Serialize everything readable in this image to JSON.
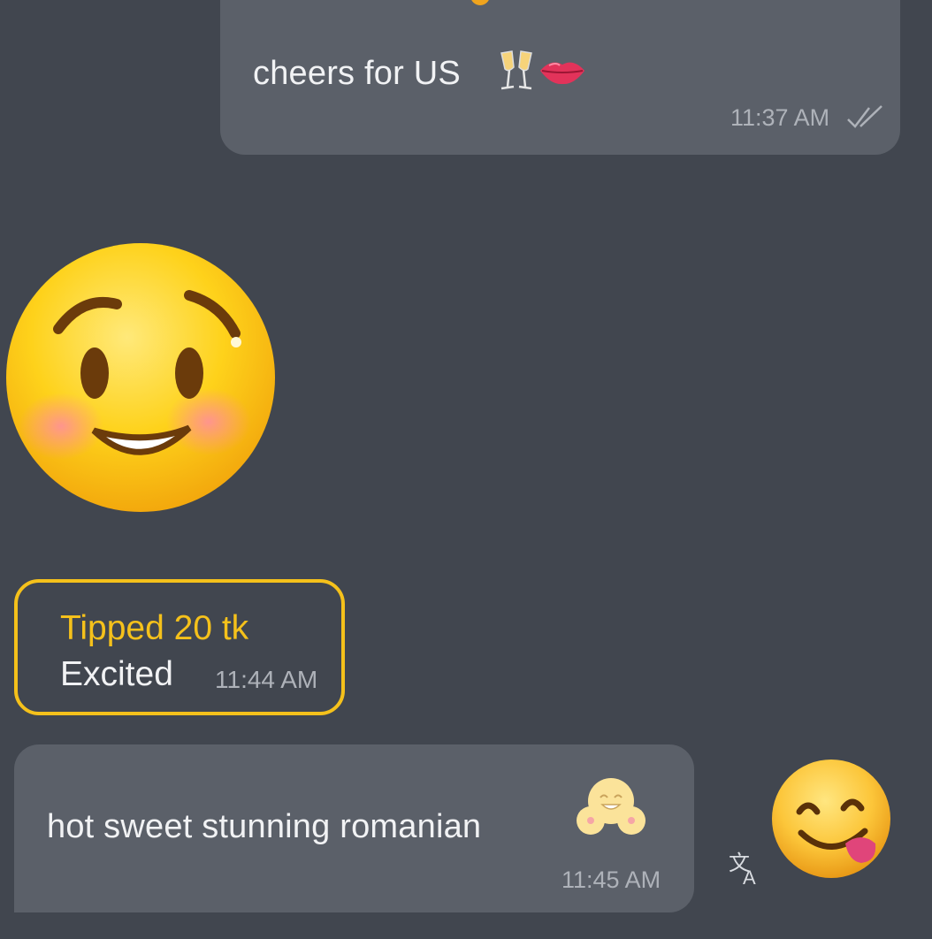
{
  "messages": {
    "outgoing": {
      "text": "cheers for US",
      "emoji_1": "champagne-glasses-icon",
      "emoji_2": "lips-icon",
      "time": "11:37 AM",
      "status_icon": "double-check-icon"
    },
    "sticker": {
      "icon": "smiling-blushing-face-icon"
    },
    "tip": {
      "title": "Tipped 20 tk",
      "subtitle": "Excited",
      "time": "11:44 AM",
      "accent": "#f5c11b"
    },
    "incoming": {
      "text": "hot sweet stunning romanian",
      "emoji": "blushing-face-icon",
      "time": "11:45 AM"
    },
    "actions": {
      "translate_icon": "translate-icon",
      "reaction_icon": "face-savoring-food-icon"
    }
  },
  "colors": {
    "background": "#41464f",
    "bubble": "#5b6069",
    "text": "#f1f2f4",
    "muted": "#aeb2b9"
  }
}
